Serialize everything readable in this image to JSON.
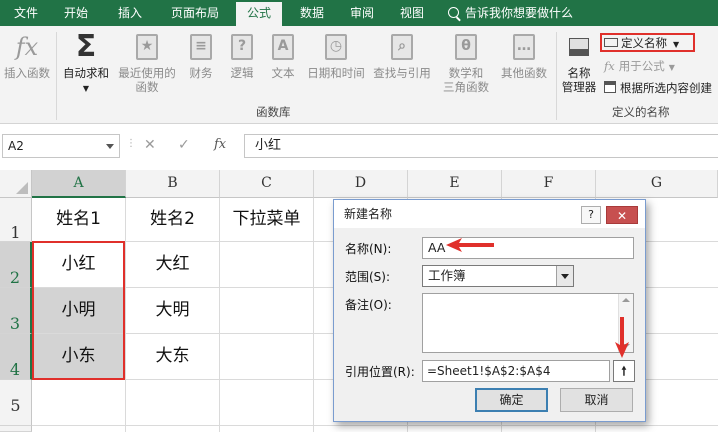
{
  "ribbon_tabs": [
    "文件",
    "开始",
    "插入",
    "页面布局",
    "公式",
    "数据",
    "审阅",
    "视图"
  ],
  "active_tab": "公式",
  "tell_me": "告诉我你想要做什么",
  "ribbon": {
    "insert_function": "插入函数",
    "autosum": "自动求和",
    "recent": [
      "最近使用的",
      "函数"
    ],
    "financial": "财务",
    "logical": "逻辑",
    "text": "文本",
    "datetime": "日期和时间",
    "lookup": "查找与引用",
    "math": [
      "数学和",
      "三角函数"
    ],
    "more": "其他函数",
    "function_library": "函数库",
    "name_manager": [
      "名称",
      "管理器"
    ],
    "define_name": "定义名称",
    "use_in_formula": "用于公式",
    "create_from_selection": "根据所选内容创建",
    "defined_names": "定义的名称"
  },
  "name_box": "A2",
  "fx": "fx",
  "formula_value": "小红",
  "columns": [
    "A",
    "B",
    "C",
    "D",
    "E",
    "F",
    "G"
  ],
  "rows": [
    "1",
    "2",
    "3",
    "4",
    "5"
  ],
  "cells": {
    "A1": "姓名1",
    "B1": "姓名2",
    "C1": "下拉菜单",
    "A2": "小红",
    "B2": "大红",
    "A3": "小明",
    "B3": "大明",
    "A4": "小东",
    "B4": "大东"
  },
  "dialog": {
    "title": "新建名称",
    "help": "?",
    "close": "✕",
    "name_label": "名称(N):",
    "name_value": "AA",
    "scope_label": "范围(S):",
    "scope_value": "工作簿",
    "comment_label": "备注(O):",
    "ref_label": "引用位置(R):",
    "ref_value": "=Sheet1!$A$2:$A$4",
    "ok": "确定",
    "cancel": "取消"
  },
  "colors": {
    "excel_green": "#217346",
    "annotation_red": "#e0302b"
  }
}
